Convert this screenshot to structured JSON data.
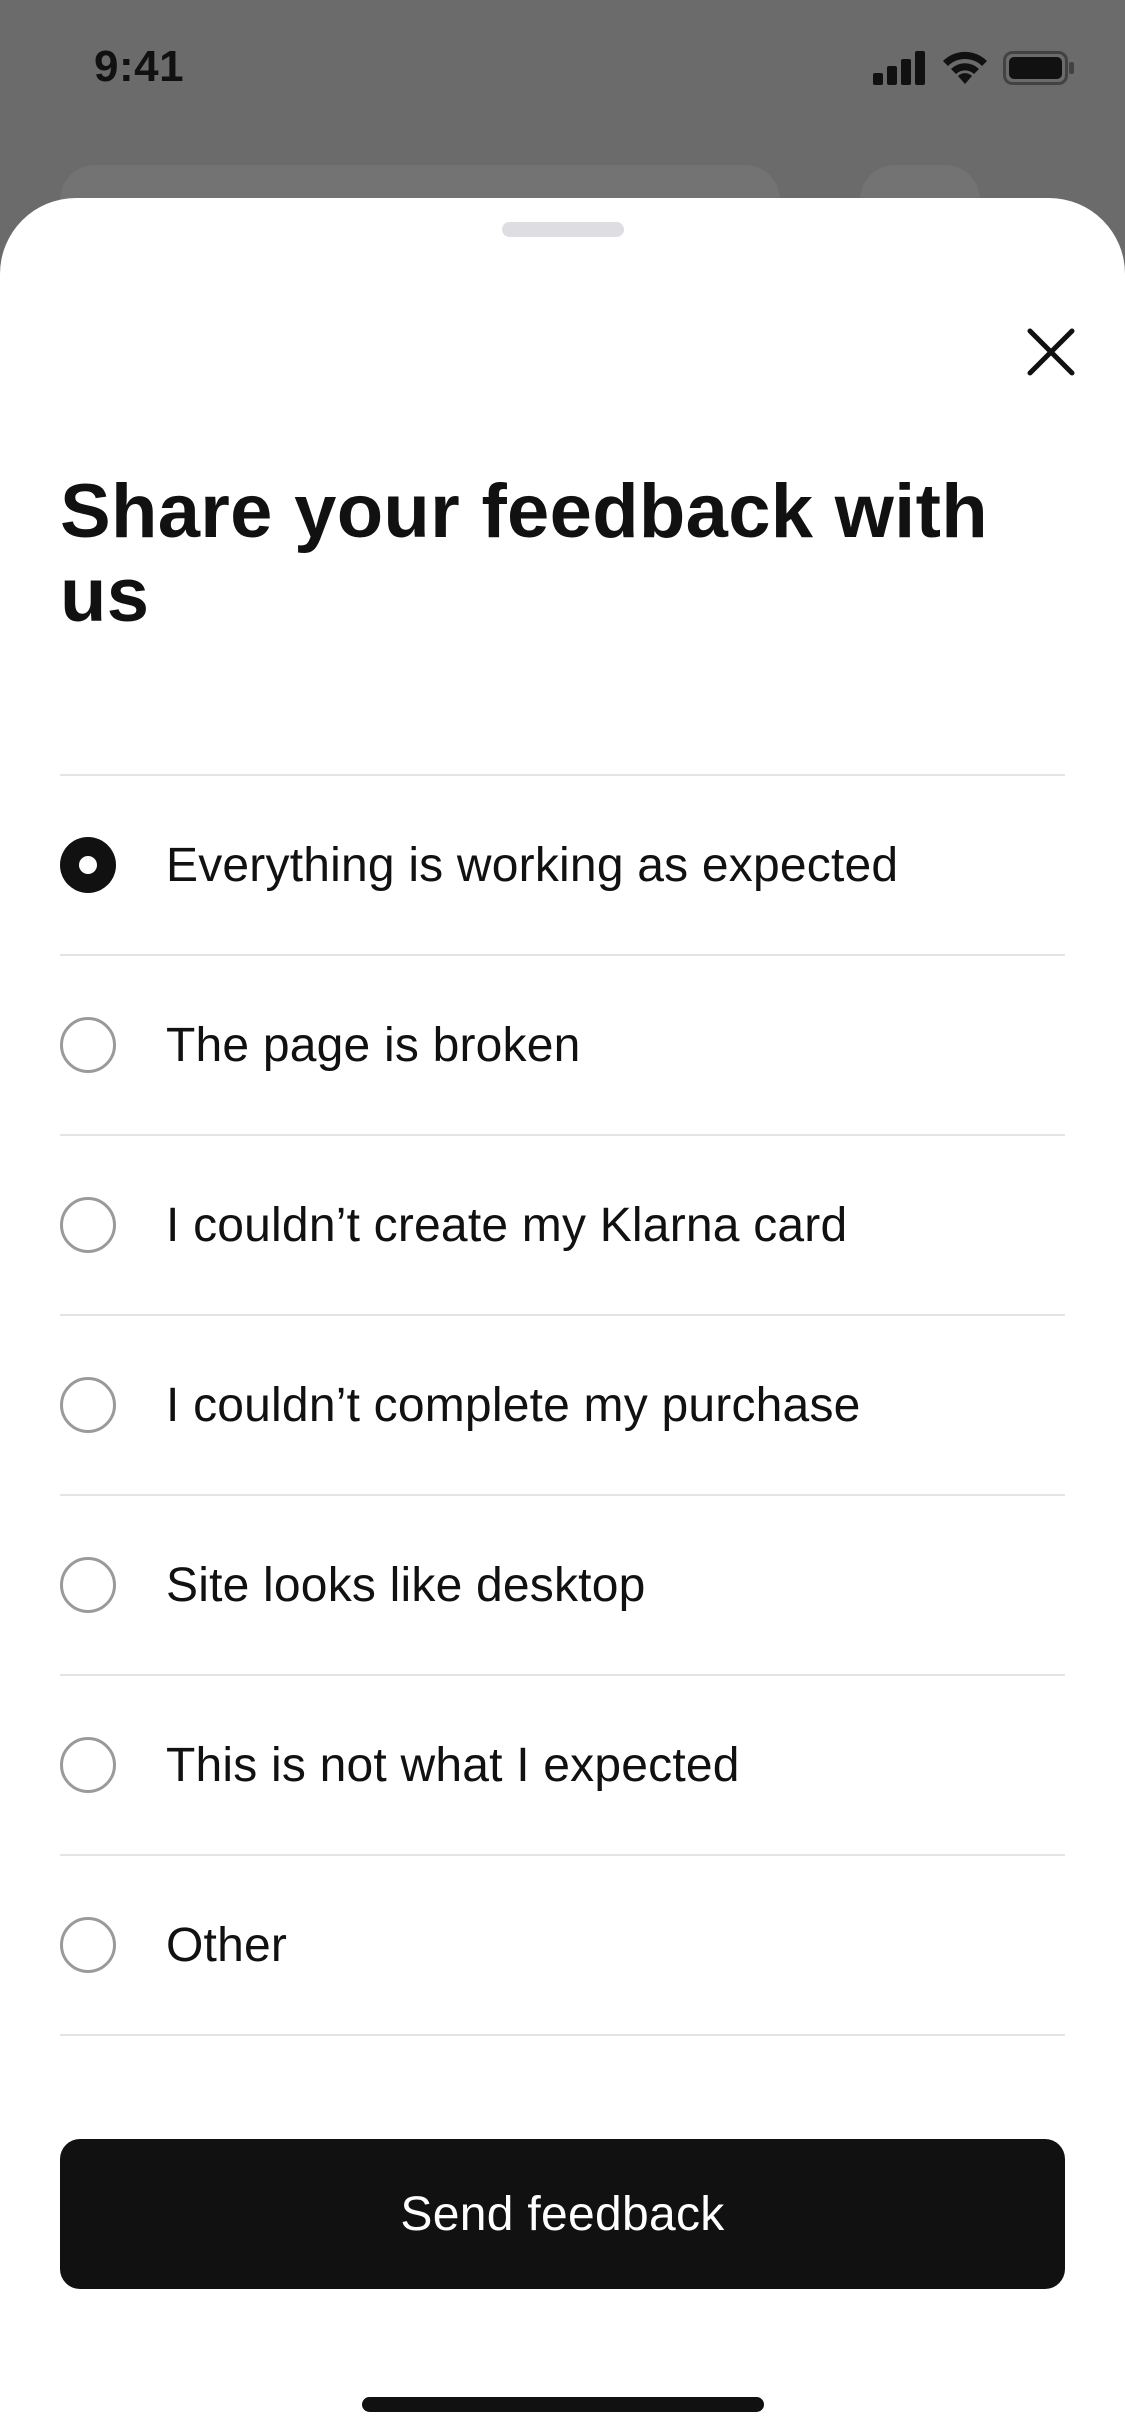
{
  "status_bar": {
    "time": "9:41",
    "icons": [
      "cellular-signal-icon",
      "wifi-icon",
      "battery-icon"
    ]
  },
  "sheet": {
    "title": "Share your feedback with us",
    "close_icon": "close-icon"
  },
  "options": [
    {
      "label": "Everything is working as expected",
      "selected": true
    },
    {
      "label": "The page is broken",
      "selected": false
    },
    {
      "label": "I couldn’t create my Klarna card",
      "selected": false
    },
    {
      "label": "I couldn’t complete my purchase",
      "selected": false
    },
    {
      "label": "Site looks like desktop",
      "selected": false
    },
    {
      "label": "This is not what I expected",
      "selected": false
    },
    {
      "label": "Other",
      "selected": false
    }
  ],
  "actions": {
    "send_label": "Send feedback"
  },
  "colors": {
    "backdrop": "#6b6b6b",
    "sheet": "#ffffff",
    "primary": "#111111",
    "divider": "#e4e4e6",
    "radio_border": "#9a9a9a"
  }
}
